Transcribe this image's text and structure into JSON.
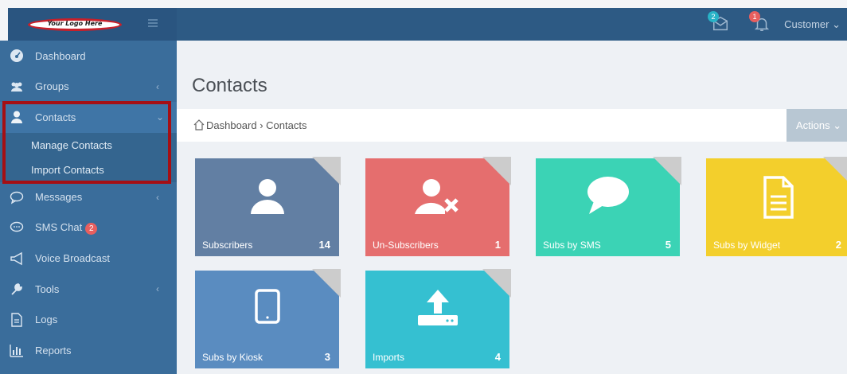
{
  "topbar": {
    "logo_text": "Your Logo Here",
    "messages_badge": "2",
    "notifications_badge": "1",
    "user_menu": "Customer ⌄",
    "colors": {
      "bar": "#2d5a84",
      "msg_badge": "#28b3c7",
      "notif_badge": "#e85f5f"
    }
  },
  "sidebar": {
    "items": [
      {
        "label": "Dashboard",
        "icon": "dashboard-icon"
      },
      {
        "label": "Groups",
        "icon": "users-icon",
        "chevron": "‹"
      },
      {
        "label": "Contacts",
        "icon": "user-icon",
        "chevron": "⌄",
        "active": true
      },
      {
        "label": "Messages",
        "icon": "speech-bubble-icon",
        "chevron": "‹"
      },
      {
        "label": "SMS Chat",
        "icon": "chat-icon",
        "badge": "2"
      },
      {
        "label": "Voice Broadcast",
        "icon": "megaphone-icon"
      },
      {
        "label": "Tools",
        "icon": "wrench-icon",
        "chevron": "‹"
      },
      {
        "label": "Logs",
        "icon": "document-icon"
      },
      {
        "label": "Reports",
        "icon": "bar-chart-icon"
      }
    ],
    "contacts_submenu": [
      "Manage Contacts",
      "Import Contacts"
    ]
  },
  "main": {
    "title": "Contacts",
    "breadcrumb": "Dashboard  ›  Contacts",
    "actions_label": "Actions ⌄"
  },
  "tiles": [
    {
      "label": "Subscribers",
      "count": "14",
      "color": "#627fa3",
      "icon": "user-icon"
    },
    {
      "label": "Un-Subscribers",
      "count": "1",
      "color": "#e56e6e",
      "icon": "user-remove-icon"
    },
    {
      "label": "Subs by SMS",
      "count": "5",
      "color": "#3bd3b5",
      "icon": "speech-bubble-icon"
    },
    {
      "label": "Subs by Widget",
      "count": "2",
      "color": "#f3cf2c",
      "icon": "document-icon"
    },
    {
      "label": "Subs by Kiosk",
      "count": "3",
      "color": "#5a8cc0",
      "icon": "tablet-icon"
    },
    {
      "label": "Imports",
      "count": "4",
      "color": "#35c0d1",
      "icon": "upload-icon"
    }
  ]
}
